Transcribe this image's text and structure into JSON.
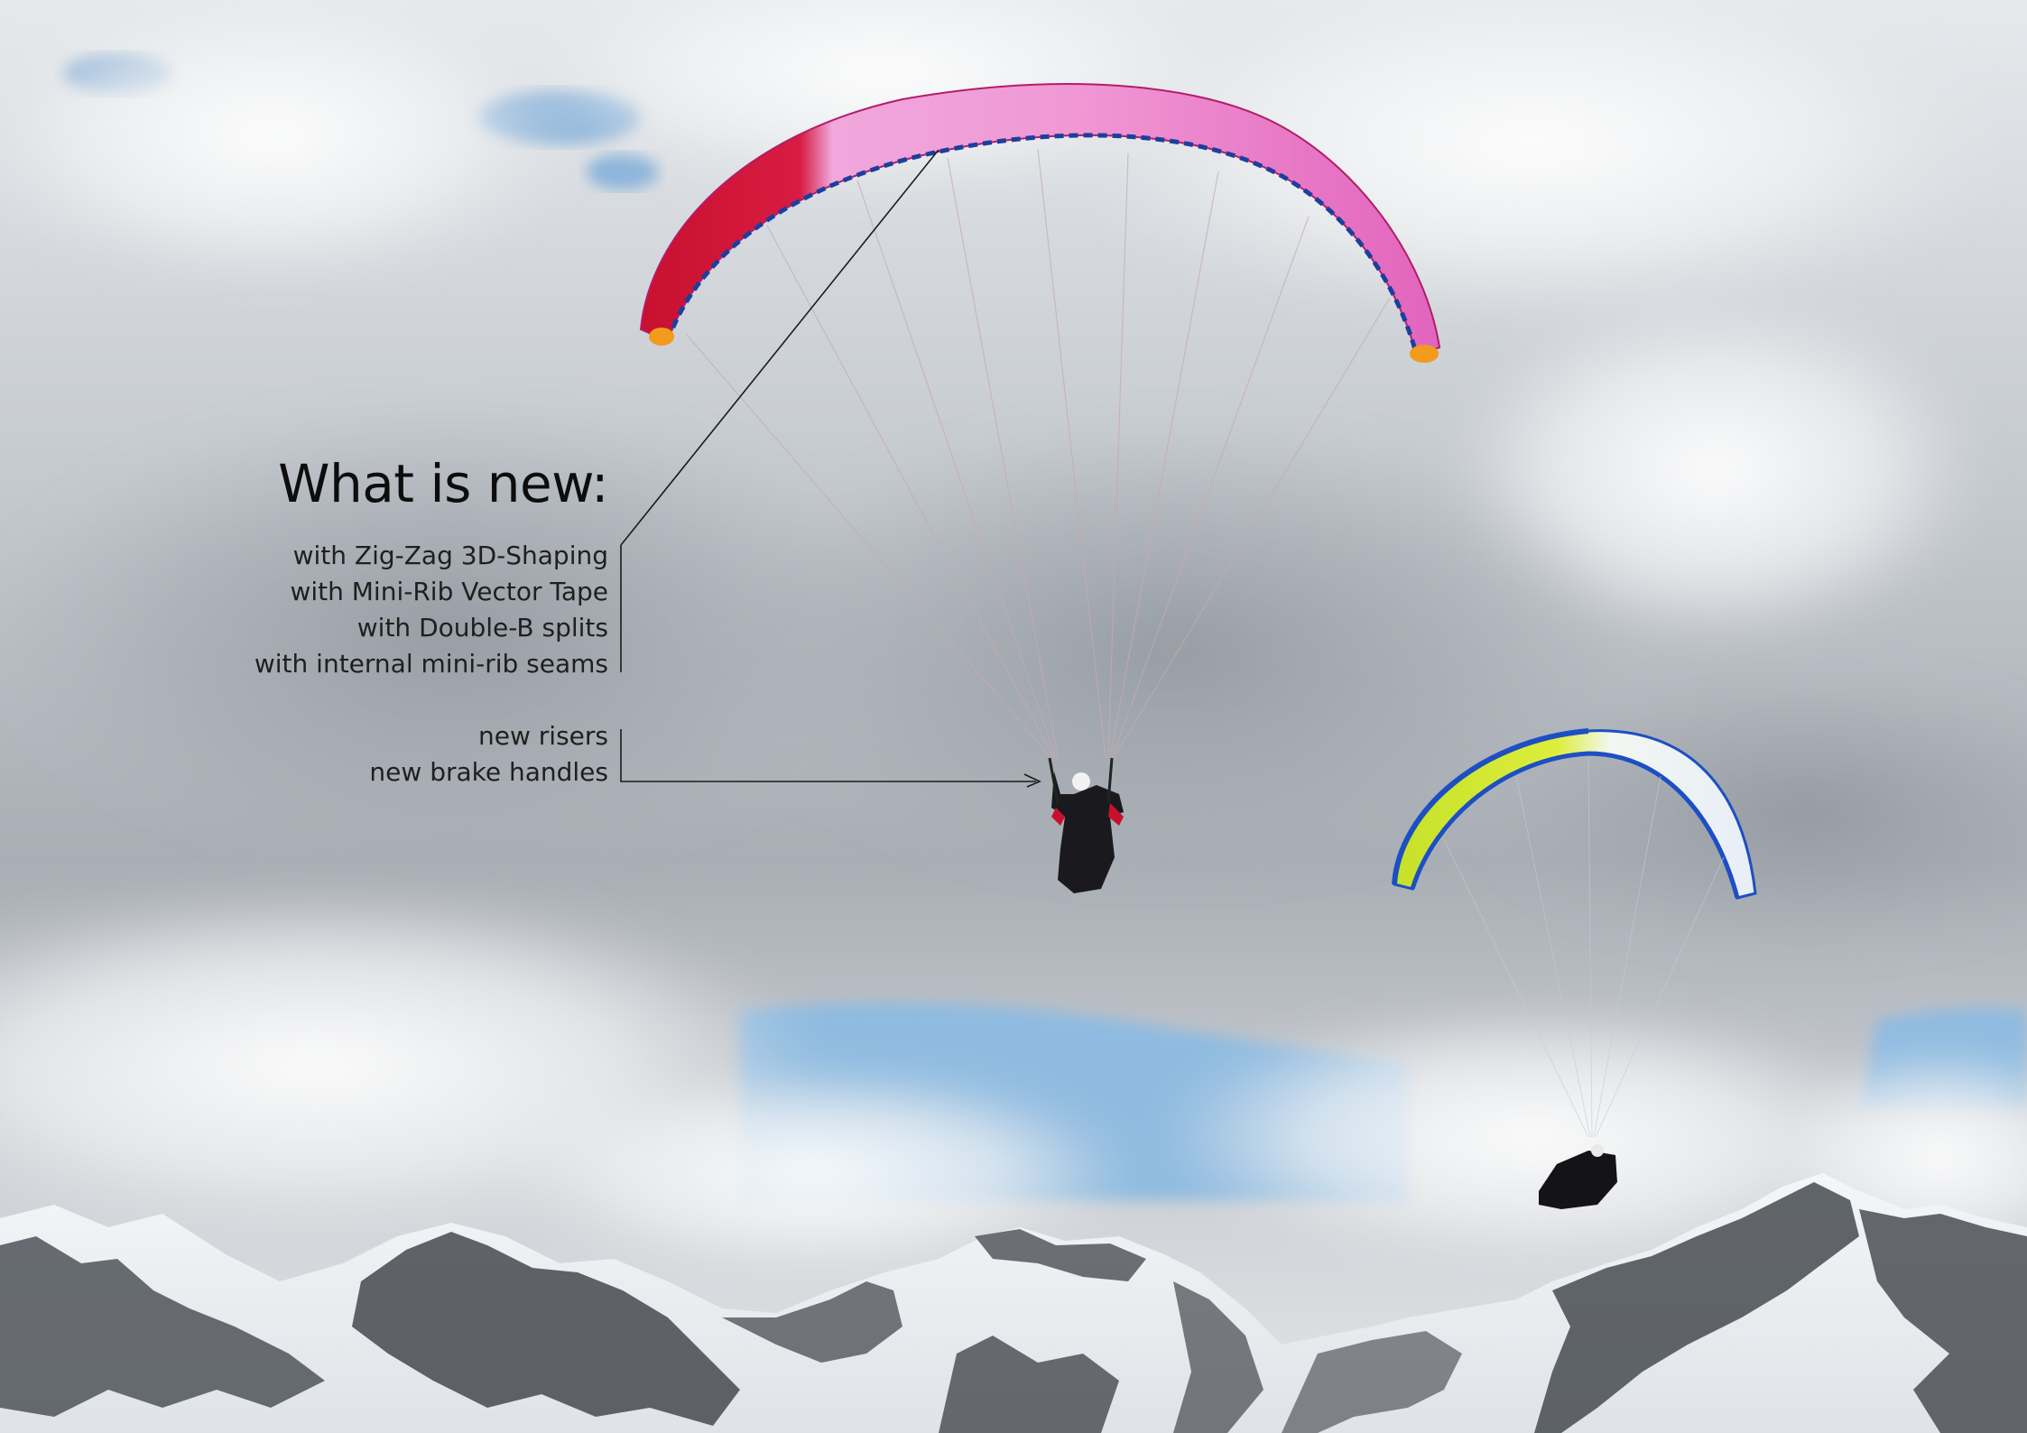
{
  "heading": "What is new:",
  "features": [
    "with Zig-Zag 3D-Shaping",
    "with Mini-Rib Vector Tape",
    "with Double-B splits",
    "with internal mini-rib seams"
  ],
  "equipment": [
    "new risers",
    "new brake handles"
  ],
  "colors": {
    "sky_blue": "#8fbbe0",
    "cloud_grey": "#b9bec4",
    "glider_pink": "#e87ec8",
    "glider_red": "#cf1e3a",
    "glider_yellow": "#d6ea2e",
    "glider_blue": "#1d4fc4",
    "mountain_rock": "#4a4d52"
  }
}
